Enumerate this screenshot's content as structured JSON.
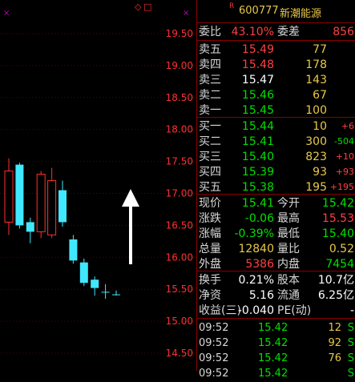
{
  "chart": {
    "y_axis_ticks": [
      "19.50",
      "19.00",
      "18.50",
      "18.00",
      "17.50",
      "17.00",
      "16.50",
      "16.00",
      "15.50",
      "15.00",
      "14.50"
    ],
    "y_axis_range": [
      14.5,
      19.5
    ],
    "top_markers": [
      "◇",
      "□"
    ],
    "candles": [
      {
        "open": 17.35,
        "close": 16.55,
        "high": 17.55,
        "low": 16.35,
        "color": "red"
      },
      {
        "open": 16.5,
        "close": 17.45,
        "high": 17.48,
        "low": 16.45,
        "color": "cyan"
      },
      {
        "open": 16.4,
        "close": 16.55,
        "high": 16.62,
        "low": 16.22,
        "color": "cyan"
      },
      {
        "open": 16.4,
        "close": 17.3,
        "high": 17.35,
        "low": 16.3,
        "color": "red"
      },
      {
        "open": 17.2,
        "close": 16.35,
        "high": 17.4,
        "low": 16.3,
        "color": "red"
      },
      {
        "open": 16.55,
        "close": 17.05,
        "high": 17.2,
        "low": 16.48,
        "color": "cyan"
      },
      {
        "open": 16.28,
        "close": 15.95,
        "high": 16.35,
        "low": 15.9,
        "color": "cyan"
      },
      {
        "open": 15.92,
        "close": 15.6,
        "high": 15.98,
        "low": 15.55,
        "color": "cyan"
      },
      {
        "open": 15.65,
        "close": 15.52,
        "high": 15.7,
        "low": 15.4,
        "color": "cyan"
      },
      {
        "open": 15.46,
        "close": 15.46,
        "high": 15.58,
        "low": 15.35,
        "color": "cyan"
      },
      {
        "open": 15.42,
        "close": 15.42,
        "high": 15.48,
        "low": 15.4,
        "color": "cyan"
      }
    ]
  },
  "header": {
    "marker": "R",
    "code": "600777",
    "name": "新潮能源"
  },
  "ratio": {
    "label1": "委比",
    "value1": "43.10%",
    "label2": "委差",
    "value2": "856"
  },
  "sell": [
    {
      "label": "卖五",
      "price": "15.49",
      "vol": "77",
      "color": "red"
    },
    {
      "label": "卖四",
      "price": "15.48",
      "vol": "178",
      "color": "red"
    },
    {
      "label": "卖三",
      "price": "15.47",
      "vol": "143",
      "color": "white"
    },
    {
      "label": "卖二",
      "price": "15.46",
      "vol": "67",
      "color": "green"
    },
    {
      "label": "卖一",
      "price": "15.45",
      "vol": "100",
      "color": "green"
    }
  ],
  "buy": [
    {
      "label": "买一",
      "price": "15.44",
      "vol": "10",
      "chg": "+6",
      "chgcolor": "red"
    },
    {
      "label": "买二",
      "price": "15.41",
      "vol": "300",
      "chg": "-504",
      "chgcolor": "green"
    },
    {
      "label": "买三",
      "price": "15.40",
      "vol": "823",
      "chg": "+10",
      "chgcolor": "red"
    },
    {
      "label": "买四",
      "price": "15.39",
      "vol": "93",
      "chg": "+93",
      "chgcolor": "red"
    },
    {
      "label": "买五",
      "price": "15.38",
      "vol": "195",
      "chg": "+195",
      "chgcolor": "red"
    }
  ],
  "quote": [
    {
      "l1": "现价",
      "v1": "15.41",
      "c1": "green",
      "l2": "今开",
      "v2": "15.42",
      "c2": "green"
    },
    {
      "l1": "涨跌",
      "v1": "-0.06",
      "c1": "green",
      "l2": "最高",
      "v2": "15.53",
      "c2": "red"
    },
    {
      "l1": "涨幅",
      "v1": "-0.39%",
      "c1": "green",
      "l2": "最低",
      "v2": "15.40",
      "c2": "green"
    },
    {
      "l1": "总量",
      "v1": "12840",
      "c1": "yellow",
      "l2": "量比",
      "v2": "0.52",
      "c2": "yellow"
    },
    {
      "l1": "外盘",
      "v1": "5386",
      "c1": "red",
      "l2": "内盘",
      "v2": "7454",
      "c2": "green"
    }
  ],
  "stats": [
    {
      "l1": "换手",
      "v1": "0.21%",
      "l2": "股本",
      "v2": "10.7亿"
    },
    {
      "l1": "净资",
      "v1": "5.16",
      "l2": "流通",
      "v2": "6.25亿"
    },
    {
      "l1": "收益(三)",
      "v1": "-0.040",
      "l2": "PE(动)",
      "v2": "-"
    }
  ],
  "trades": [
    {
      "time": "09:52",
      "price": "15.42",
      "vol": "12",
      "side": "S"
    },
    {
      "time": "09:52",
      "price": "15.42",
      "vol": "92",
      "side": "S"
    },
    {
      "time": "09:52",
      "price": "15.42",
      "vol": "76",
      "side": "S"
    },
    {
      "time": "09:52",
      "price": "15.42",
      "vol": "",
      "side": "S"
    }
  ]
}
